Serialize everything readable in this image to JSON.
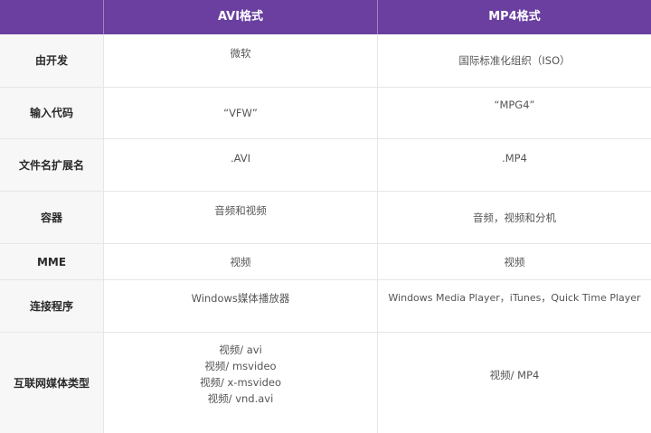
{
  "header": {
    "col0": "",
    "col1": "AVI格式",
    "col2": "MP4格式"
  },
  "rows": [
    {
      "label": "由开发",
      "avi": "微软",
      "mp4": "国际标准化组织（ISO）"
    },
    {
      "label": "输入代码",
      "avi": "“VFW”",
      "mp4": "“MPG4”"
    },
    {
      "label": "文件名扩展名",
      "avi": ".AVI",
      "mp4": ".MP4"
    },
    {
      "label": "容器",
      "avi": "音频和视频",
      "mp4": "音频，视频和分机"
    },
    {
      "label": "MME",
      "avi": "视频",
      "mp4": "视频"
    },
    {
      "label": "连接程序",
      "avi": "Windows媒体播放器",
      "mp4": "Windows Media Player，iTunes，Quick Time Player"
    },
    {
      "label": "互联网媒体类型",
      "avi_lines": [
        "视频/ avi",
        "视频/ msvideo",
        "视频/ x-msvideo",
        "视频/ vnd.avi"
      ],
      "mp4": "视频/ MP4"
    }
  ],
  "colors": {
    "header_bg": "#6a3fa0",
    "label_bg": "#f7f7f7",
    "border": "#e6e6e6"
  }
}
